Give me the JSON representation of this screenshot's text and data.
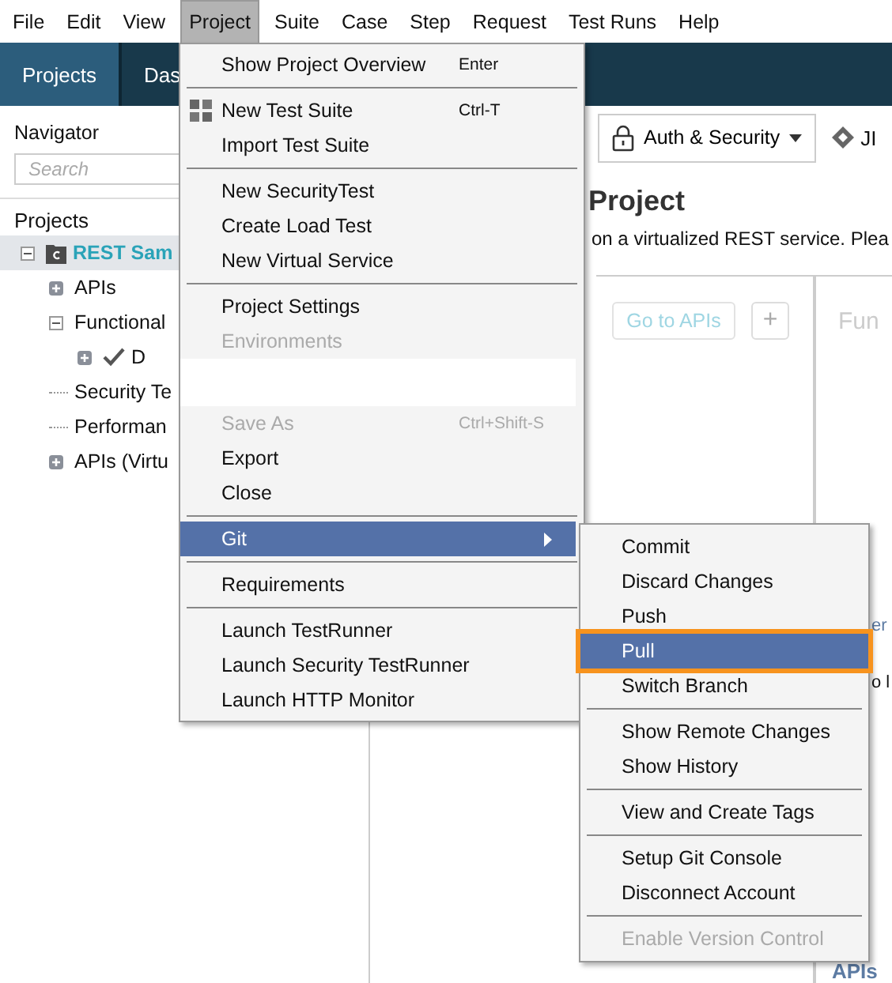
{
  "menubar": [
    {
      "label": "File",
      "selected": false
    },
    {
      "label": "Edit",
      "selected": false
    },
    {
      "label": "View",
      "selected": false
    },
    {
      "label": "Project",
      "selected": true
    },
    {
      "label": "Suite",
      "selected": false
    },
    {
      "label": "Case",
      "selected": false
    },
    {
      "label": "Step",
      "selected": false
    },
    {
      "label": "Request",
      "selected": false
    },
    {
      "label": "Test Runs",
      "selected": false
    },
    {
      "label": "Help",
      "selected": false
    }
  ],
  "header_tabs": [
    {
      "label": "Projects",
      "selected": true
    },
    {
      "label": "Das",
      "selected": false
    }
  ],
  "navigator": {
    "title": "Navigator",
    "search_placeholder": "Search",
    "projects_label": "Projects",
    "tree": [
      {
        "kind": "project",
        "label": "REST Sam",
        "expanded": true,
        "selected": true,
        "children": [
          {
            "kind": "folder",
            "label": "APIs",
            "expanded": false,
            "selected": false
          },
          {
            "kind": "folder",
            "label": "Functional",
            "expanded": true,
            "selected": false,
            "children": [
              {
                "kind": "testcase",
                "label": "D",
                "expanded": false,
                "selected": false
              }
            ]
          },
          {
            "kind": "leaf",
            "label": "Security Te",
            "selected": false
          },
          {
            "kind": "leaf",
            "label": "Performan",
            "selected": false
          },
          {
            "kind": "folder",
            "label": "APIs (Virtu",
            "expanded": false,
            "selected": false
          }
        ]
      }
    ]
  },
  "toolbar": {
    "auth_button": "Auth & Security",
    "jira_label": "JI"
  },
  "content": {
    "heading": "Project",
    "description": "on a virtualized REST service. Plea",
    "go_to_apis": "Go to APIs",
    "add_button": "+",
    "panel_title": "Fun",
    "lower_texts": [
      "er",
      "o l"
    ],
    "bottom_title": "APIs"
  },
  "project_menu": [
    {
      "kind": "item",
      "label": "Show Project Overview",
      "shortcut": "Enter",
      "disabled": false,
      "selected": false
    },
    {
      "kind": "separator"
    },
    {
      "kind": "iconitem",
      "label": "New Test Suite",
      "shortcut": "Ctrl-T",
      "disabled": false,
      "selected": false
    },
    {
      "kind": "item",
      "label": "Import Test Suite",
      "disabled": false,
      "selected": false
    },
    {
      "kind": "separator"
    },
    {
      "kind": "item",
      "label": "New SecurityTest",
      "disabled": false,
      "selected": false
    },
    {
      "kind": "item",
      "label": "Create Load Test",
      "disabled": false,
      "selected": false
    },
    {
      "kind": "item",
      "label": "New Virtual Service",
      "disabled": false,
      "selected": false
    },
    {
      "kind": "separator"
    },
    {
      "kind": "item",
      "label": "Project Settings",
      "disabled": false,
      "selected": false
    },
    {
      "kind": "item",
      "label": "Environments",
      "disabled": true,
      "selected": false
    },
    {
      "kind": "blank"
    },
    {
      "kind": "item",
      "label": "Save As",
      "shortcut": "Ctrl+Shift-S",
      "disabled": true,
      "selected": false
    },
    {
      "kind": "item",
      "label": "Export",
      "disabled": false,
      "selected": false
    },
    {
      "kind": "item",
      "label": "Close",
      "disabled": false,
      "selected": false
    },
    {
      "kind": "separator"
    },
    {
      "kind": "submenu",
      "label": "Git",
      "disabled": false,
      "selected": true
    },
    {
      "kind": "separator"
    },
    {
      "kind": "item",
      "label": "Requirements",
      "disabled": false,
      "selected": false
    },
    {
      "kind": "separator"
    },
    {
      "kind": "item",
      "label": "Launch TestRunner",
      "disabled": false,
      "selected": false
    },
    {
      "kind": "item",
      "label": "Launch Security TestRunner",
      "disabled": false,
      "selected": false
    },
    {
      "kind": "item",
      "label": "Launch HTTP Monitor",
      "disabled": false,
      "selected": false
    }
  ],
  "git_submenu": [
    {
      "kind": "item",
      "label": "Commit",
      "disabled": false,
      "selected": false
    },
    {
      "kind": "item",
      "label": "Discard Changes",
      "disabled": false,
      "selected": false
    },
    {
      "kind": "item",
      "label": "Push",
      "disabled": false,
      "selected": false
    },
    {
      "kind": "item",
      "label": "Pull",
      "disabled": false,
      "selected": true,
      "outlined": true
    },
    {
      "kind": "item",
      "label": "Switch Branch",
      "disabled": false,
      "selected": false
    },
    {
      "kind": "separator"
    },
    {
      "kind": "item",
      "label": "Show Remote Changes",
      "disabled": false,
      "selected": false
    },
    {
      "kind": "item",
      "label": "Show History",
      "disabled": false,
      "selected": false
    },
    {
      "kind": "separator"
    },
    {
      "kind": "item",
      "label": "View and Create Tags",
      "disabled": false,
      "selected": false
    },
    {
      "kind": "separator"
    },
    {
      "kind": "item",
      "label": "Setup Git Console",
      "disabled": false,
      "selected": false
    },
    {
      "kind": "item",
      "label": "Disconnect Account",
      "disabled": false,
      "selected": false
    },
    {
      "kind": "separator"
    },
    {
      "kind": "item",
      "label": "Enable Version Control",
      "disabled": true,
      "selected": false
    }
  ]
}
